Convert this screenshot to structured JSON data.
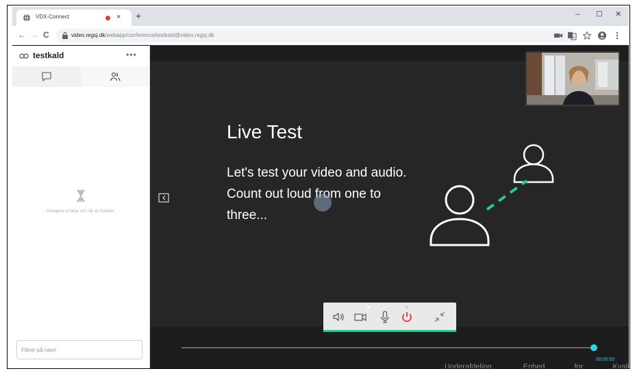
{
  "browser": {
    "tab_title": "VDX-Connect",
    "tab_close": "×",
    "new_tab": "+",
    "window_minimize": "–",
    "window_maximize": "☐",
    "window_close": "✕",
    "back": "←",
    "forward": "→",
    "reload": "C",
    "url_host": "video.regsj.dk",
    "url_path": "/webapp/conference/testkald@video.regsj.dk"
  },
  "sidebar": {
    "room_name": "testkald",
    "more": "•••",
    "empty_message": "Deltagere vil blive vist når du tilslutter.",
    "filter_placeholder": "Filtrer på navn"
  },
  "main": {
    "heading": "Live Test",
    "body": "Let's test your video and audio. Count out loud from one to three...",
    "timer": "00:00:03",
    "background_ticker": "Underafdeling. Enhed for Kvalitetsudvikli"
  },
  "colors": {
    "accent": "#1fcf8c",
    "hangup": "#e53935",
    "timeline": "#2dd4e8",
    "panel_bg": "#262626"
  }
}
